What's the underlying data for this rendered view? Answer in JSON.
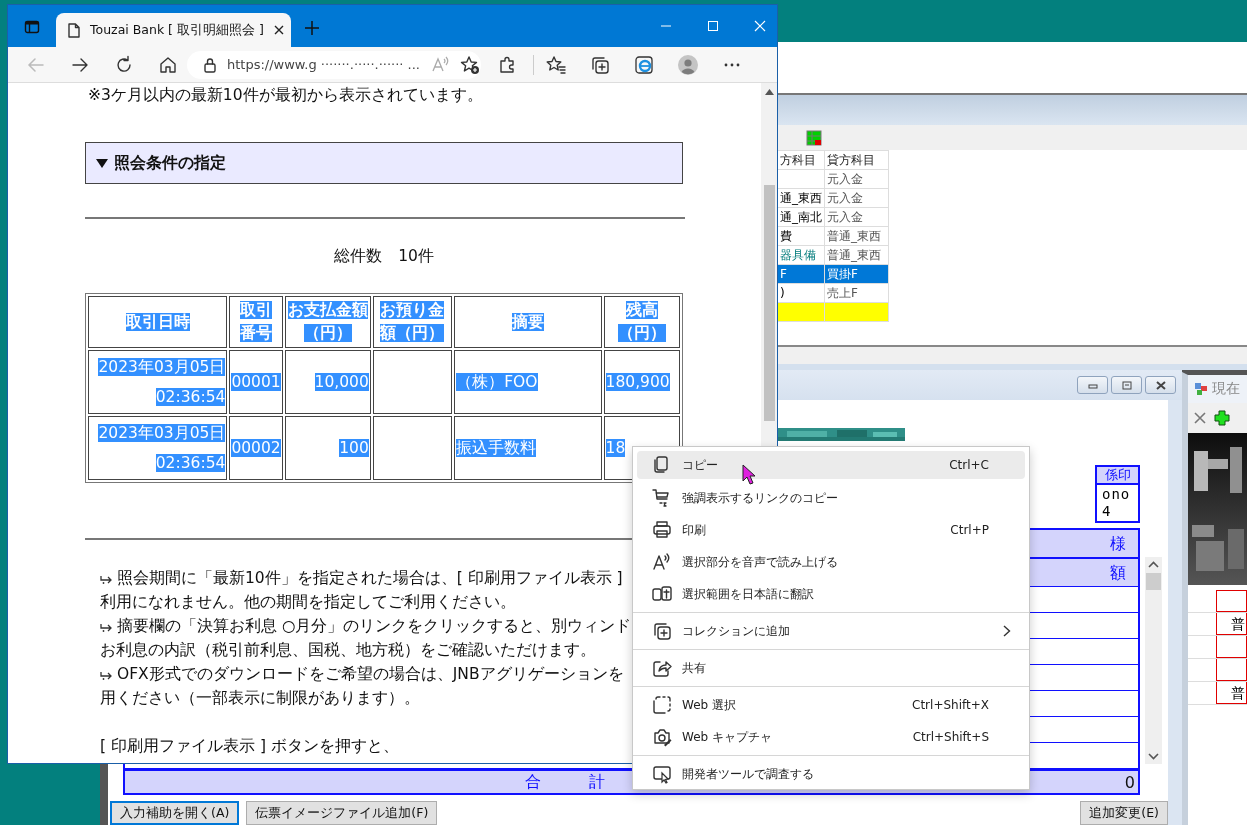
{
  "browser": {
    "tab_title": "Touzai Bank [ 取引明細照会 ]",
    "address": "https://www.g ·······.·····.······ ...",
    "page": {
      "notice": "※3ケ月以内の最新10件が最初から表示されています。",
      "conditions": {
        "label": "照会条件の指定",
        "expanded": true
      },
      "total": "総件数　10件",
      "table": {
        "highlighted": true,
        "columns": [
          "取引日時",
          "取引番号",
          "お支払金額（円）",
          "お預り金額（円）",
          "摘要",
          "残高（円）"
        ],
        "rows": [
          {
            "datetime": "2023年03月05日\n02:36:54",
            "number": "00001",
            "payment": "10,000",
            "description": "（株）FOO",
            "balance": "180,900"
          },
          {
            "datetime": "2023年03月05日\n02:36:54",
            "number": "00002",
            "payment": "100",
            "description": "振込手数料",
            "balance": "18"
          }
        ]
      },
      "notes": [
        {
          "kind": "bullet",
          "lines": [
            "照会期間に「最新10件」を指定された場合は、[ 印刷用ファイル表示 ]",
            "利用になれません。他の期間を指定してご利用ください。"
          ]
        },
        {
          "kind": "bullet",
          "lines": [
            "摘要欄の「決算お利息 ○月分」のリンクをクリックすると、別ウィンド",
            "お利息の内訳（税引前利息、国税、地方税）をご確認いただけます。"
          ]
        },
        {
          "kind": "bullet",
          "lines": [
            "OFX形式でのダウンロードをご希望の場合は、JNBアグリゲーションを",
            "用ください（一部表示に制限があります）。"
          ]
        },
        {
          "kind": "plain",
          "lines": [
            "[ 印刷用ファイル表示 ] ボタンを押すと、"
          ]
        }
      ]
    }
  },
  "context_menu": {
    "items": [
      {
        "label": "コピー",
        "shortcut": "Ctrl+C",
        "selected": true
      },
      {
        "label": "強調表示するリンクのコピー",
        "selected": false
      },
      {
        "label": "印刷",
        "shortcut": "Ctrl+P",
        "selected": false
      },
      {
        "label": "選択部分を音声で読み上げる",
        "selected": false
      },
      {
        "label": "選択範囲を日本語に翻訳",
        "selected": false
      },
      {
        "label": "コレクションに追加",
        "submenu": true,
        "separator_before": true,
        "selected": false
      },
      {
        "label": "共有",
        "separator_before": true,
        "selected": false
      },
      {
        "label": "Web 選択",
        "shortcut": "Ctrl+Shift+X",
        "separator_before": true,
        "selected": false
      },
      {
        "label": "Web キャプチャ",
        "shortcut": "Ctrl+Shift+S",
        "selected": false
      },
      {
        "label": "開発者ツールで調査する",
        "separator_before": true,
        "selected": false
      }
    ]
  },
  "journal_window": {
    "columns": [
      "方科目",
      "貸方科目"
    ],
    "input_row": true,
    "rows": [
      {
        "credit": "元入金",
        "emphasized": false,
        "selected": false
      },
      {
        "debit": "通_東西",
        "credit": "元入金",
        "emphasized": false,
        "selected": false
      },
      {
        "debit": "通_南北",
        "credit": "元入金",
        "emphasized": false,
        "selected": false
      },
      {
        "debit": "費",
        "credit": "普通_東西",
        "emphasized": false,
        "selected": false
      },
      {
        "debit": "器具備",
        "credit": "普通_東西",
        "emphasized": true,
        "selected": false
      },
      {
        "debit": "F",
        "credit": "買掛F",
        "emphasized": false,
        "selected": true
      },
      {
        "debit": ")",
        "credit": "売上F",
        "emphasized": false,
        "selected": false
      }
    ]
  },
  "voucher_window": {
    "stamp": {
      "label": "係印",
      "value": "ono4"
    },
    "header_rows": [
      "様",
      "額"
    ],
    "total": {
      "label": "合　　　計",
      "value": "0"
    },
    "left_buttons": [
      {
        "label": "入力補助を開く(A)",
        "focused": true
      },
      {
        "label": "伝票イメージファイル追加(F)",
        "focused": false
      }
    ],
    "right_buttons": [
      {
        "label": "追加変更(E)",
        "focused": false
      }
    ]
  },
  "status_window": {
    "title": "現在",
    "rows": [
      {
        "kind": "blank"
      },
      {
        "kind": "text",
        "text": "普"
      },
      {
        "kind": "blank"
      },
      {
        "kind": "blank"
      },
      {
        "kind": "text",
        "text": "普"
      }
    ]
  }
}
